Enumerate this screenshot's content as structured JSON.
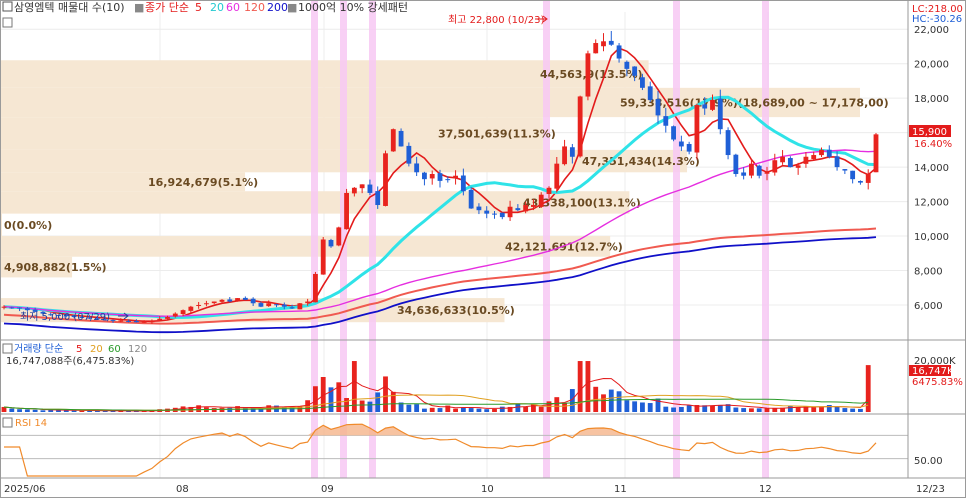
{
  "header": {
    "stock_selector": "삼영엠텍 매물대 수(10)",
    "ma_label_prefix": "종가 단순",
    "ma_periods": [
      "5",
      "20",
      "60",
      "120",
      "200"
    ],
    "pattern_label": "1000억 10% 강세패턴"
  },
  "right_info": {
    "lc": "LC:218.00",
    "hc": "HC:-30.26"
  },
  "price_panel": {
    "high_annotation": "최고 22,800 (10/23)",
    "low_annotation": "최저 5,000 (07/29)",
    "current_price_tag": "15,900",
    "current_change_tag": "16.40%",
    "y_ticks": [
      "22,000",
      "20,000",
      "18,000",
      "16,000",
      "14,000",
      "12,000",
      "10,000",
      "8,000",
      "6,000"
    ],
    "zone_labels": [
      "44,563,9(13.5%)",
      "59,338,516(17.9%)(18,689,00 ~ 17,178,00)",
      "37,501,639(11.3%)",
      "47,351,434(14.3%)",
      "16,924,679(5.1%)",
      "43,338,100(13.1%)",
      "0(0.0%)",
      "42,121,691(12.7%)",
      "4,908,882(1.5%)",
      "34,636,633(10.5%)"
    ]
  },
  "volume_panel": {
    "legend_prefix": "거래량 단순",
    "legend_periods": [
      "5",
      "20",
      "60",
      "120"
    ],
    "volume_text": "16,747,088주(6,475.83%)",
    "y_tick": "20,000K",
    "current_tag": "16,747K",
    "current_pct": "6475.83%"
  },
  "rsi_panel": {
    "label": "RSI 14",
    "y_tick": "50.00"
  },
  "x_axis": {
    "labels": [
      "2025/06",
      "08",
      "09",
      "10",
      "11",
      "12",
      "12/23"
    ]
  },
  "colors": {
    "up": "#e8231e",
    "down": "#1f5fd6",
    "ma5": "#e31b1b",
    "ma20": "#2fe3e8",
    "ma60": "#e52ee0",
    "ma120": "#f05a50",
    "ma200": "#1010c8",
    "zone": "#f6e7d3",
    "highlight": "#f7c8f3",
    "rsi": "#f08a2a"
  },
  "chart_data": {
    "type": "candlestick",
    "price_unit": "KRW",
    "y_range": [
      4200,
      23000
    ],
    "high": {
      "value": 22800,
      "date": "10/23"
    },
    "low": {
      "value": 5000,
      "date": "07/29"
    },
    "last_close": 15900,
    "last_change_pct": 16.4,
    "volume_profile": [
      {
        "volume": 44563900,
        "pct": 13.5
      },
      {
        "volume": 59338516,
        "pct": 17.9,
        "range": [
          18689,
          17178
        ]
      },
      {
        "volume": 37501639,
        "pct": 11.3
      },
      {
        "volume": 47351434,
        "pct": 14.3
      },
      {
        "volume": 16924679,
        "pct": 5.1
      },
      {
        "volume": 43338100,
        "pct": 13.1
      },
      {
        "volume": 0,
        "pct": 0.0
      },
      {
        "volume": 42121691,
        "pct": 12.7
      },
      {
        "volume": 4908882,
        "pct": 1.5
      },
      {
        "volume": 34636633,
        "pct": 10.5
      }
    ],
    "closes": [
      5900,
      5850,
      5800,
      5700,
      5600,
      5500,
      5450,
      5400,
      5350,
      5300,
      5300,
      5250,
      5200,
      5150,
      5100,
      5100,
      5050,
      5000,
      5050,
      5100,
      5200,
      5300,
      5500,
      5700,
      5900,
      6000,
      6100,
      6200,
      6300,
      6200,
      6400,
      6300,
      6100,
      5900,
      6100,
      6000,
      5900,
      5800,
      6100,
      6200,
      7800,
      9800,
      9400,
      10500,
      12500,
      12800,
      13000,
      12500,
      11800,
      14800,
      16200,
      15200,
      14200,
      13700,
      13300,
      13600,
      13200,
      13300,
      13500,
      12600,
      11600,
      11500,
      11300,
      11300,
      11100,
      11700,
      11500,
      11800,
      11800,
      12400,
      12800,
      14200,
      15200,
      14600,
      18100,
      20600,
      21200,
      21300,
      21100,
      20300,
      19700,
      19300,
      18600,
      17900,
      17000,
      16400,
      15600,
      15200,
      14900,
      17600,
      17400,
      17900,
      16200,
      14700,
      13600,
      13500,
      14200,
      13500,
      13700,
      14400,
      14600,
      14000,
      14100,
      14600,
      14700,
      15000,
      14600,
      14000,
      13800,
      13300,
      13100,
      13600,
      15900
    ],
    "volume_k": [
      1800,
      1200,
      1000,
      900,
      800,
      600,
      700,
      650,
      600,
      500,
      450,
      400,
      500,
      420,
      380,
      350,
      360,
      340,
      320,
      500,
      1000,
      1200,
      1500,
      2000,
      1800,
      2400,
      1700,
      1400,
      1500,
      1500,
      2100,
      1600,
      1400,
      1400,
      2400,
      2300,
      1800,
      1900,
      2000,
      4200,
      9200,
      12500,
      8800,
      10600,
      5000,
      18200,
      4100,
      3700,
      7000,
      12700,
      7200,
      3400,
      2600,
      2800,
      1200,
      1500,
      1400,
      2300,
      1200,
      1700,
      1400,
      1200,
      1000,
      1100,
      1900,
      1800,
      3100,
      1800,
      2700,
      1900,
      3800,
      5300,
      3200,
      8200,
      18200,
      18200,
      9000,
      6300,
      8000,
      7400,
      4200,
      3800,
      3400,
      3200,
      4800,
      1900,
      1600,
      1800,
      2400,
      2500,
      2400,
      2300,
      2400,
      2800,
      1600,
      1400,
      1300,
      1300,
      1400,
      1300,
      1500,
      2300,
      1700,
      1900,
      1700,
      1800,
      2500,
      1800,
      1400,
      1200,
      1100,
      16747
    ],
    "volume_y_tick": 20000,
    "rsi_level_tick": 50,
    "highlighted_periods": 6,
    "ma_periods": [
      5,
      20,
      60,
      120,
      200
    ]
  }
}
